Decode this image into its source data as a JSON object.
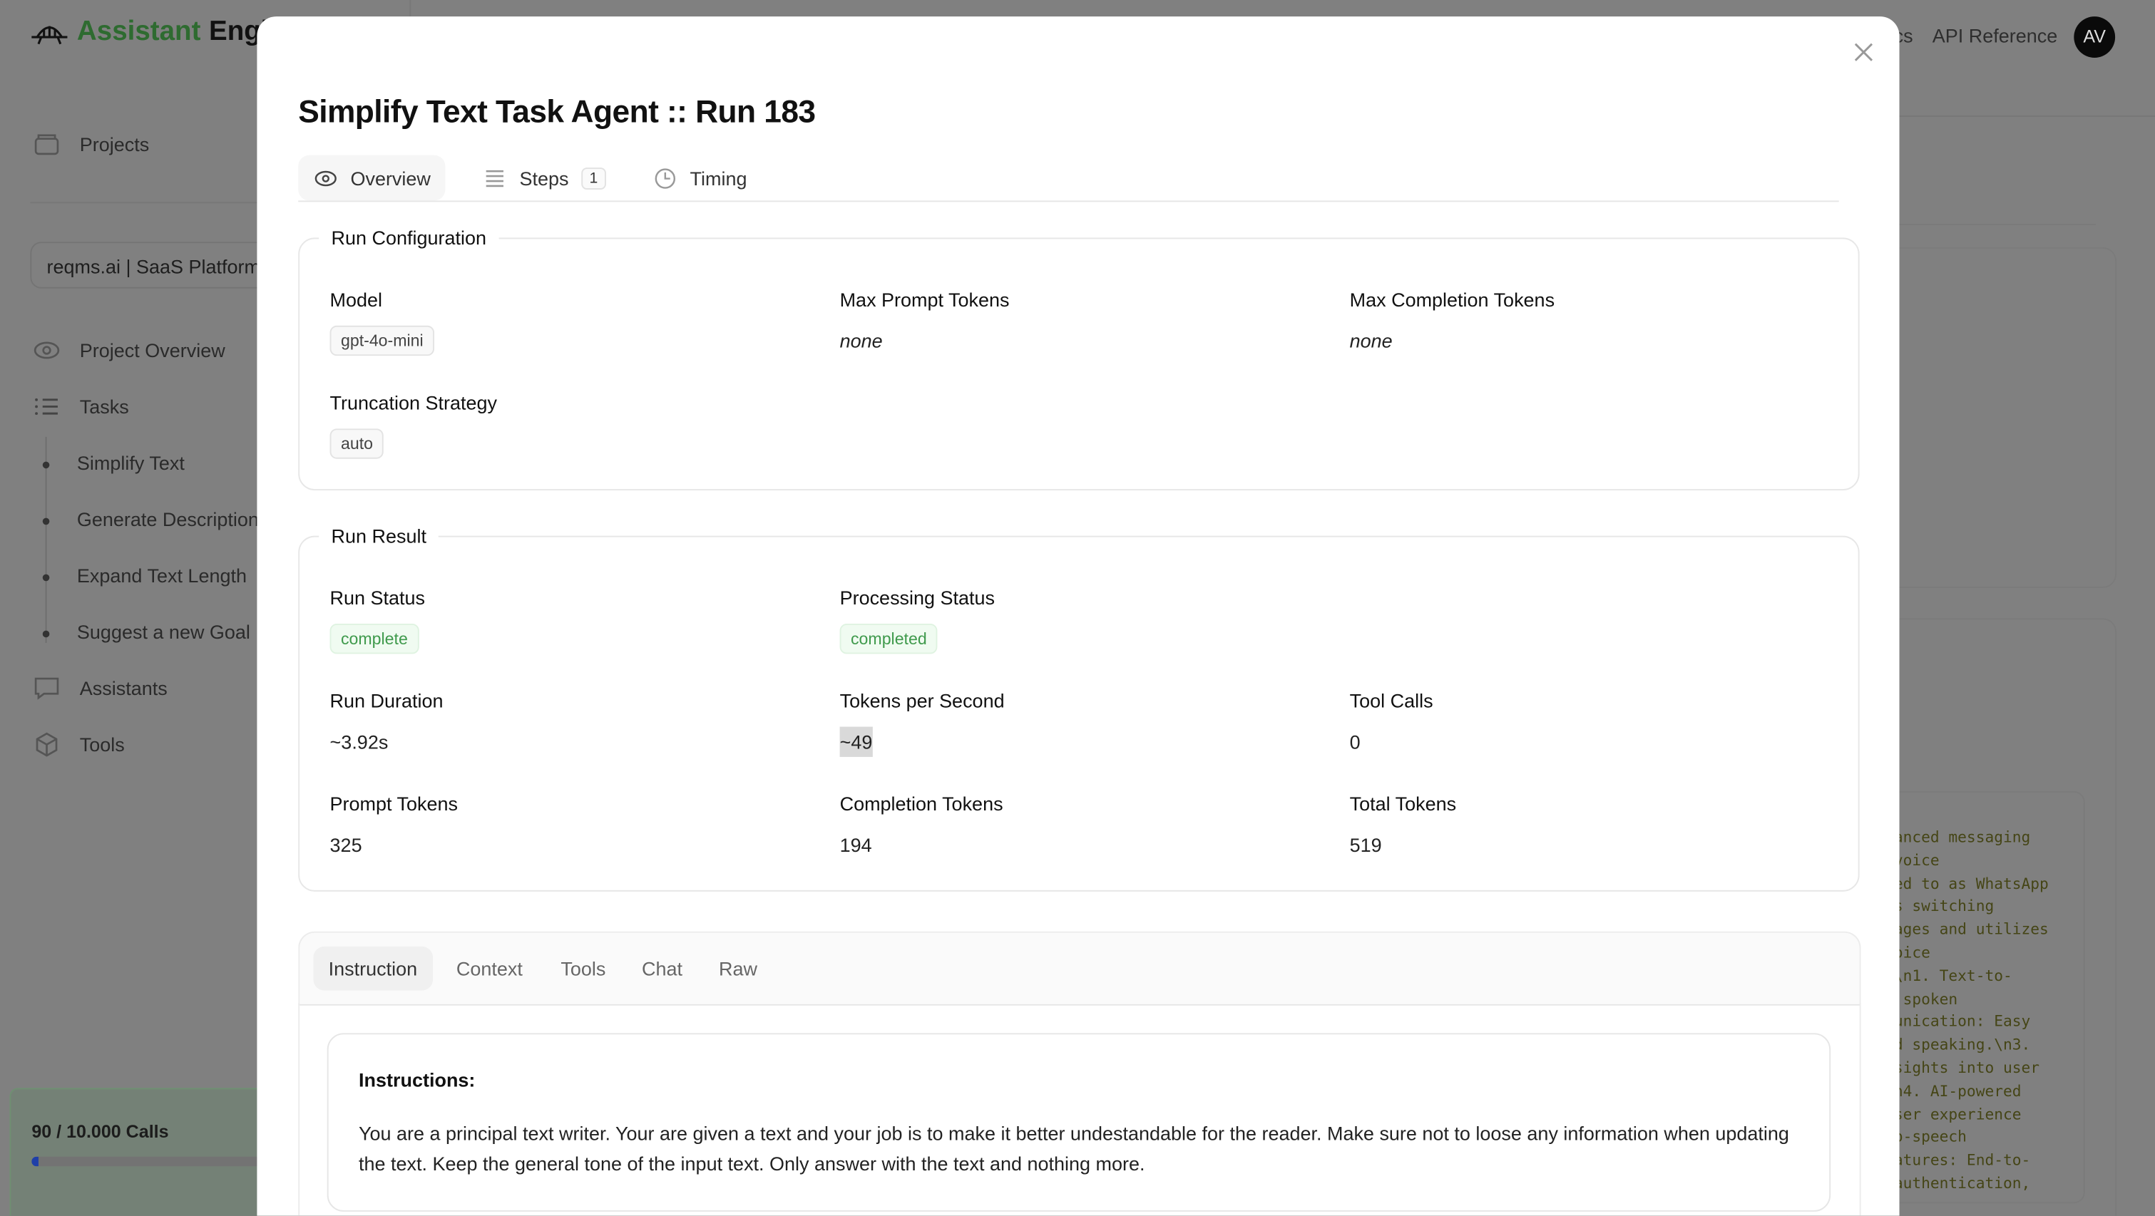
{
  "app": {
    "brand_part1": "Assistant",
    "brand_part2": "Engine",
    "nav": {
      "projects": "Projects",
      "project_overview": "Project Overview",
      "tasks": "Tasks",
      "assistants": "Assistants",
      "tools": "Tools"
    },
    "project_selector": "reqms.ai | SaaS Platform",
    "task_items": [
      "Simplify Text",
      "Generate Description",
      "Expand Text Length",
      "Suggest a new Goal"
    ],
    "usage": {
      "label": "90 / 10.000 Calls",
      "used": 90,
      "limit": 10000
    },
    "top_links": {
      "docs": "Docs",
      "api_reference": "API Reference"
    },
    "avatar_initials": "AV",
    "background_code_fragments": [
      "anced messaging",
      "voice",
      "ed to as WhatsApp",
      "s switching",
      "ages and utilizes",
      "oice",
      "\\n1. Text-to-",
      " spoken",
      "unication: Easy",
      "d speaking.\\n3.",
      "sights into user",
      "n4. AI-powered",
      "ser experience",
      "o-speech",
      "atures: End-to-",
      "authentication,"
    ]
  },
  "modal": {
    "title": "Simplify Text Task Agent :: Run 183",
    "tabs": [
      {
        "label": "Overview",
        "icon": "eye-icon",
        "active": true
      },
      {
        "label": "Steps",
        "icon": "list-icon",
        "badge": "1"
      },
      {
        "label": "Timing",
        "icon": "clock-icon"
      }
    ],
    "run_configuration": {
      "legend": "Run Configuration",
      "model_label": "Model",
      "model_value": "gpt-4o-mini",
      "max_prompt_label": "Max Prompt Tokens",
      "max_prompt_value": "none",
      "max_completion_label": "Max Completion Tokens",
      "max_completion_value": "none",
      "truncation_label": "Truncation Strategy",
      "truncation_value": "auto"
    },
    "run_result": {
      "legend": "Run Result",
      "run_status_label": "Run Status",
      "run_status_value": "complete",
      "processing_status_label": "Processing Status",
      "processing_status_value": "completed",
      "duration_label": "Run Duration",
      "duration_value": "~3.92s",
      "tps_label": "Tokens per Second",
      "tps_value": "~49",
      "tool_calls_label": "Tool Calls",
      "tool_calls_value": "0",
      "prompt_tokens_label": "Prompt Tokens",
      "prompt_tokens_value": "325",
      "completion_tokens_label": "Completion Tokens",
      "completion_tokens_value": "194",
      "total_tokens_label": "Total Tokens",
      "total_tokens_value": "519"
    },
    "detail_tabs": [
      "Instruction",
      "Context",
      "Tools",
      "Chat",
      "Raw"
    ],
    "instruction": {
      "heading": "Instructions:",
      "text": "You are a principal text writer. Your are given a text and your job is to make it better undestandable for the reader. Make sure not to loose any information when updating the text. Keep the general tone of the input text. Only answer with the text and nothing more."
    }
  },
  "colors": {
    "brand_green": "#2e6b30",
    "status_green": "#3f9a4c",
    "usage_bar": "#1f3fa8"
  }
}
